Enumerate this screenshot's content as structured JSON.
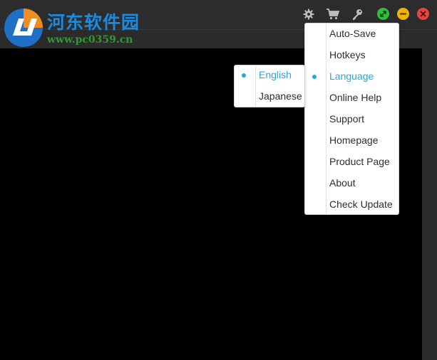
{
  "watermark": {
    "name": "河东软件园",
    "url": "www.pc0359.cn"
  },
  "toolbar": {
    "icons": [
      "gear-icon",
      "cart-icon",
      "key-icon"
    ],
    "window_controls": [
      {
        "name": "restore-button",
        "color": "#2fbf3a"
      },
      {
        "name": "minimize-button",
        "color": "#f0b400"
      },
      {
        "name": "close-button",
        "color": "#e8453c"
      }
    ]
  },
  "settings_menu": {
    "items": [
      {
        "label": "Auto-Save",
        "selected": false
      },
      {
        "label": "Hotkeys",
        "selected": false
      },
      {
        "label": "Language",
        "selected": true
      },
      {
        "label": "Online Help",
        "selected": false
      },
      {
        "label": "Support",
        "selected": false
      },
      {
        "label": "Homepage",
        "selected": false
      },
      {
        "label": "Product Page",
        "selected": false
      },
      {
        "label": "About",
        "selected": false
      },
      {
        "label": "Check Update",
        "selected": false
      }
    ]
  },
  "language_submenu": {
    "items": [
      {
        "label": "English",
        "selected": true
      },
      {
        "label": "Japanese",
        "selected": false
      }
    ]
  },
  "colors": {
    "accent": "#29a4dc",
    "canvas": "#000000",
    "titlebar": "#2c2c2c"
  }
}
